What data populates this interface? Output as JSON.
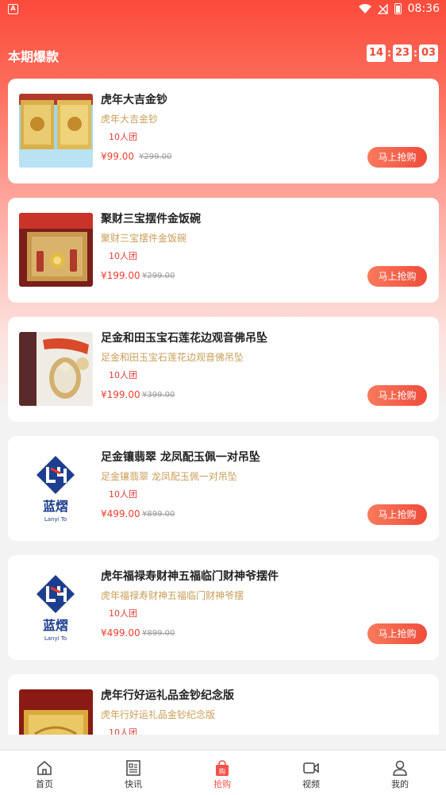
{
  "status_bar": {
    "app_badge": "A",
    "time": "08:36"
  },
  "header": {
    "title": "本期爆款",
    "countdown": {
      "hours": "14",
      "minutes": "23",
      "seconds": "03",
      "separator": ":"
    }
  },
  "products": [
    {
      "title": "虎年大吉金钞",
      "subtitle": "虎年大吉金钞",
      "group": "10人团",
      "price": "¥99.00",
      "old_price": "¥299.00",
      "button": "马上抢购",
      "image": "gold-banknote"
    },
    {
      "title": "聚财三宝摆件金饭碗",
      "subtitle": "聚财三宝摆件金饭碗",
      "group": "10人团",
      "price": "¥199.00",
      "old_price": "¥299.00",
      "button": "马上抢购",
      "image": "gold-bowl-set"
    },
    {
      "title": "足金和田玉宝石莲花边观音佛吊坠",
      "subtitle": "足金和田玉宝石莲花边观音佛吊坠",
      "group": "10人团",
      "price": "¥199.00",
      "old_price": "¥399.00",
      "button": "马上抢购",
      "image": "jade-pendant"
    },
    {
      "title": "足金镶翡翠 龙凤配玉佩一对吊坠",
      "subtitle": "足金镶翡翠 龙凤配玉佩一对吊坠",
      "group": "10人团",
      "price": "¥499.00",
      "old_price": "¥899.00",
      "button": "马上抢购",
      "image": "lanyi-logo",
      "logo_text": "蓝熠",
      "logo_sub": "Lanyi To"
    },
    {
      "title": "虎年福禄寿财神五福临门财神爷摆件",
      "subtitle": "虎年福禄寿财神五福临门财神爷摆",
      "group": "10人团",
      "price": "¥499.00",
      "old_price": "¥899.00",
      "button": "马上抢购",
      "image": "lanyi-logo",
      "logo_text": "蓝熠",
      "logo_sub": "Lanyi To"
    },
    {
      "title": "虎年行好运礼品金钞纪念版",
      "subtitle": "虎年行好运礼品金钞纪念版",
      "group": "10人团",
      "price": "",
      "old_price": "",
      "button": "",
      "image": "gold-banknote-red"
    }
  ],
  "tabbar": [
    {
      "label": "首页",
      "icon": "home-icon",
      "active": false
    },
    {
      "label": "快讯",
      "icon": "news-icon",
      "active": false
    },
    {
      "label": "抢购",
      "icon": "shopping-bag-icon",
      "active": true
    },
    {
      "label": "视频",
      "icon": "video-icon",
      "active": false
    },
    {
      "label": "我的",
      "icon": "profile-icon",
      "active": false
    }
  ],
  "colors": {
    "accent": "#f04c3c",
    "gold_text": "#c89e58",
    "price": "#f04030"
  }
}
